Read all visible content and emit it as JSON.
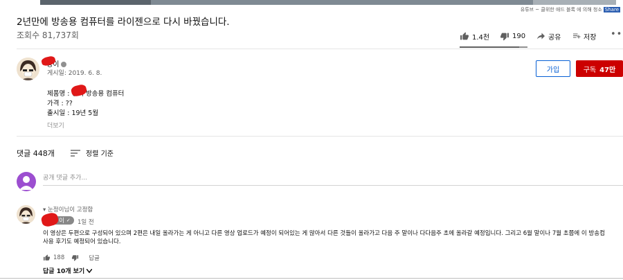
{
  "watermark": {
    "text": "유튜브 ~ 클위한 애드 블록 에 의해 청소",
    "share": "Share"
  },
  "video": {
    "title": "2년만에 방송용 컴퓨터를 라이젠으로 다시 바꿨습니다.",
    "views": "조회수 81,737회",
    "likes": "1.4천",
    "dislikes": "190",
    "share_label": "공유",
    "save_label": "저장",
    "more_label": "•••",
    "like_ratio": 0.88
  },
  "channel": {
    "name": "정이",
    "published": "게시일: 2019. 6. 8.",
    "join_label": "가입",
    "subscribe_label": "구독",
    "subscriber_count": "47만"
  },
  "description": {
    "lines": [
      "제품명 : 정이 방송용 컴퓨터",
      "가격 : ??",
      "출시일 : 19년 5월"
    ],
    "more_label": "더보기"
  },
  "comments": {
    "count_label": "댓글 448개",
    "sort_label": "정렬 기준",
    "add_placeholder": "공개 댓글 추가...",
    "pinned": {
      "pinned_label": "눈정이님이 고정함",
      "author": "이",
      "time": "1일 전",
      "text": "이 영상은 두편으로 구성되어 있으며 2편은 내일 올라가는 게 아니고 다른 영상 업로드가 예정이 되어있는 게 많아서 다른 것들이 올라가고 다음 주 말이나 다다음주 초에 올라갈 예정입니다. 그리고 6월 말이나 7월 초쯤에 이 방송컴 사용 후기도 예정되어 있습니다.",
      "likes": "188",
      "reply_label": "답글",
      "view_replies": "답글 10개 보기"
    }
  },
  "colors": {
    "subscribe": "#cc0000",
    "join_border": "#065fd4",
    "user_avatar": "#9c4ed0"
  }
}
